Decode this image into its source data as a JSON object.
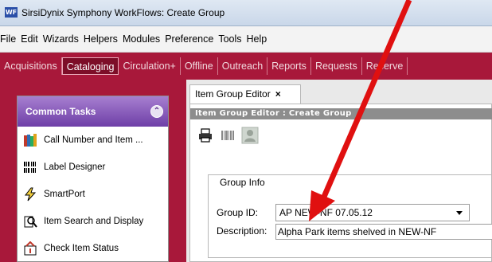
{
  "window": {
    "app_icon": "WF",
    "title": "SirsiDynix Symphony WorkFlows: Create Group"
  },
  "menubar": {
    "items": [
      "File",
      "Edit",
      "Wizards",
      "Helpers",
      "Modules",
      "Preference",
      "Tools",
      "Help"
    ]
  },
  "modules": {
    "tabs": [
      "Acquisitions",
      "Cataloging",
      "Circulation+",
      "Offline",
      "Outreach",
      "Reports",
      "Requests",
      "Reserve"
    ],
    "active": "Cataloging"
  },
  "common_tasks": {
    "title": "Common Tasks",
    "items": [
      {
        "label": "Call Number and Item ...",
        "icon": "books-icon"
      },
      {
        "label": "Label Designer",
        "icon": "barcode-icon"
      },
      {
        "label": "SmartPort",
        "icon": "lightning-icon"
      },
      {
        "label": "Item Search and Display",
        "icon": "search-icon"
      },
      {
        "label": "Check Item Status",
        "icon": "status-icon"
      }
    ]
  },
  "editor": {
    "tab_label": "Item Group Editor",
    "tab_close": "×",
    "header": "Item Group Editor : Create Group",
    "toolbar": [
      "print-icon",
      "barcode-scan-icon",
      "helper-icon"
    ],
    "group_info": {
      "legend": "Group Info",
      "group_id_label": "Group ID:",
      "group_id_value": "AP NEW-NF 07.05.12",
      "description_label": "Description:",
      "description_value": "Alpha Park items shelved in NEW-NF"
    }
  },
  "colors": {
    "module_bar": "#a8183a",
    "annotation_arrow": "#e01010",
    "tasks_header": "#6e3fa7"
  }
}
